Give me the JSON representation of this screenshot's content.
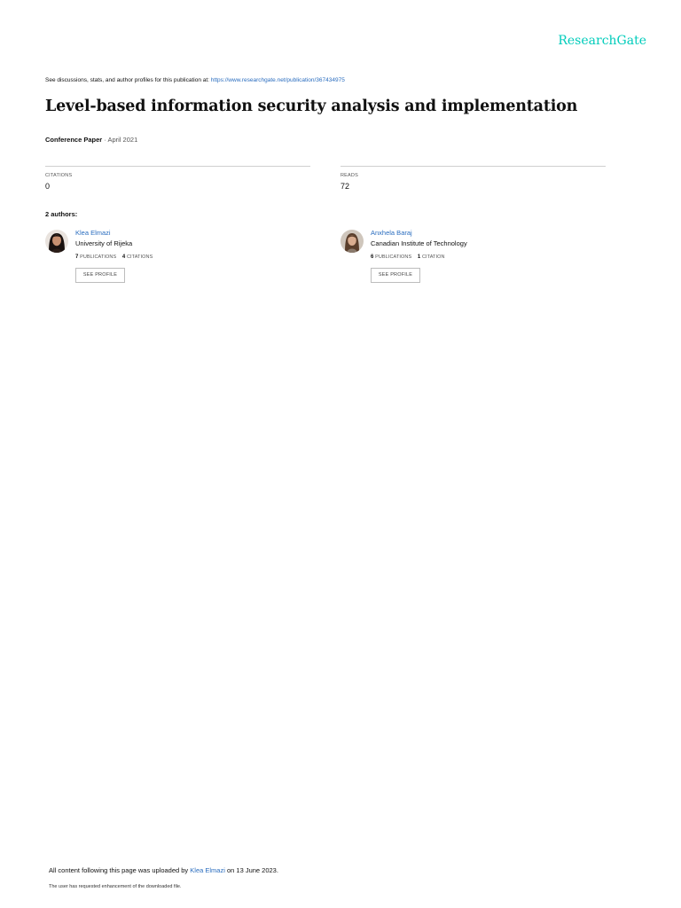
{
  "brand": {
    "name": "ResearchGate"
  },
  "header": {
    "see_discussions_text": "See discussions, stats, and author profiles for this publication at: ",
    "publication_url": "https://www.researchgate.net/publication/367434975"
  },
  "publication": {
    "title": "Level-based information security analysis and implementation",
    "type": "Conference Paper",
    "separator": " · ",
    "date": "April 2021"
  },
  "stats": {
    "citations_label": "CITATIONS",
    "citations_value": "0",
    "reads_label": "READS",
    "reads_value": "72"
  },
  "authors_heading": "2 authors:",
  "authors": [
    {
      "name": "Klea Elmazi",
      "institution": "University of Rijeka",
      "publications_count": "7",
      "publications_label": "PUBLICATIONS",
      "citations_count": "4",
      "citations_label": "CITATIONS",
      "profile_button": "SEE PROFILE"
    },
    {
      "name": "Anxhela Baraj",
      "institution": "Canadian Institute of Technology",
      "publications_count": "6",
      "publications_label": "PUBLICATIONS",
      "citations_count": "1",
      "citations_label": "CITATION",
      "profile_button": "SEE PROFILE"
    }
  ],
  "footer": {
    "uploaded_prefix": "All content following this page was uploaded by ",
    "uploader": "Klea Elmazi",
    "uploaded_suffix": " on 13 June 2023.",
    "enhancement_note": "The user has requested enhancement of the downloaded file."
  },
  "colors": {
    "brand": "#00ccbb",
    "link": "#2a6dbf",
    "text": "#111111",
    "divider": "#cfcfcf"
  }
}
